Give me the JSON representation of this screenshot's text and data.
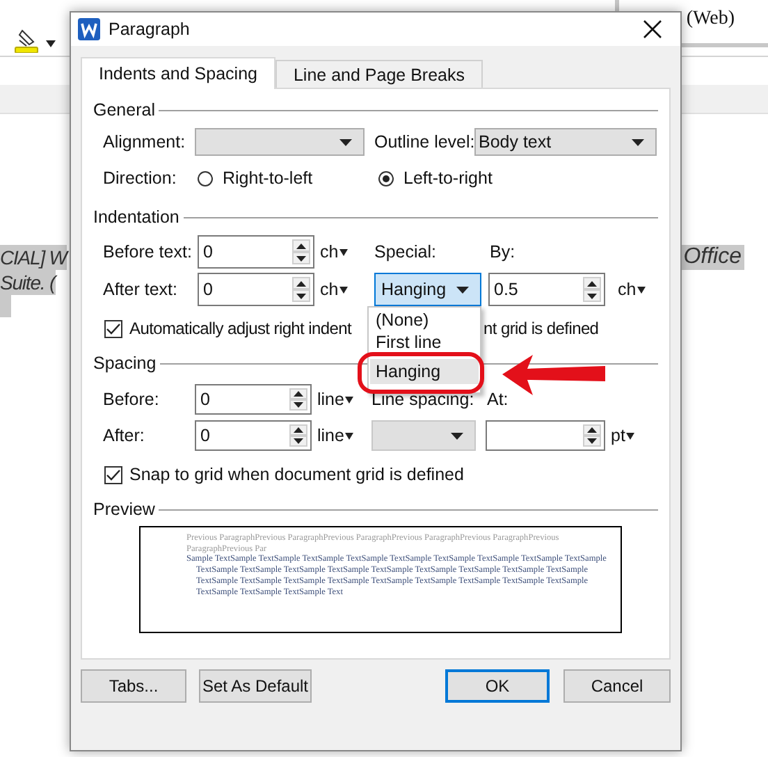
{
  "background": {
    "ribbon_label": "(Web)",
    "document_lines": [
      {
        "text": "CIAL] W",
        "kind": "left"
      },
      {
        "text": "Office",
        "kind": "right"
      },
      {
        "text": "Suite. (",
        "kind": "left"
      }
    ]
  },
  "window": {
    "title": "Paragraph"
  },
  "tabs": [
    {
      "label": "Indents and Spacing",
      "selected": true
    },
    {
      "label": "Line and Page Breaks",
      "selected": false
    }
  ],
  "general": {
    "title": "General",
    "alignment": {
      "label": "Alignment:"
    },
    "outline_level": {
      "label": "Outline level:",
      "value": "Body text"
    },
    "direction": {
      "label": "Direction:",
      "options": [
        {
          "label": "Right-to-left",
          "selected": false
        },
        {
          "label": "Left-to-right",
          "selected": true
        }
      ]
    }
  },
  "indentation": {
    "title": "Indentation",
    "before_text": {
      "label": "Before text:",
      "value": "0",
      "unit": "ch"
    },
    "after_text": {
      "label": "After text:",
      "value": "0",
      "unit": "ch"
    },
    "special": {
      "label": "Special:",
      "value": "Hanging",
      "options": [
        {
          "label": "(None)",
          "selected": false
        },
        {
          "label": "First line",
          "selected": false
        },
        {
          "label": "Hanging",
          "selected": true
        }
      ]
    },
    "by": {
      "label": "By:",
      "value": "0.5",
      "unit": "ch"
    },
    "auto_adjust": {
      "label": "Automatically adjust right indent",
      "label_tail": "nt grid is defined",
      "checked": true
    }
  },
  "spacing": {
    "title": "Spacing",
    "before": {
      "label": "Before:",
      "value": "0",
      "unit": "line"
    },
    "after": {
      "label": "After:",
      "value": "0",
      "unit": "line"
    },
    "line_spacing": {
      "label": "Line spacing:",
      "disabled": true
    },
    "at": {
      "label": "At:",
      "unit": "pt"
    },
    "snap": {
      "label": "Snap to grid when document grid is defined",
      "checked": true
    }
  },
  "preview": {
    "title": "Preview",
    "previous_text": "Previous ParagraphPrevious ParagraphPrevious ParagraphPrevious ParagraphPrevious ParagraphPrevious ParagraphPrevious Par",
    "sample_text": "Sample TextSample TextSample TextSample TextSample TextSample TextSample TextSample TextSample TextSample TextSample TextSample TextSample TextSample TextSample TextSample TextSample TextSample TextSample TextSample TextSample TextSample TextSample TextSample TextSample TextSample TextSample TextSample TextSample TextSample TextSample Text"
  },
  "buttons": [
    {
      "label": "Tabs...",
      "kind": "normal"
    },
    {
      "label": "Set As Default",
      "kind": "normal"
    },
    {
      "label": "OK",
      "kind": "default"
    },
    {
      "label": "Cancel",
      "kind": "normal"
    }
  ]
}
